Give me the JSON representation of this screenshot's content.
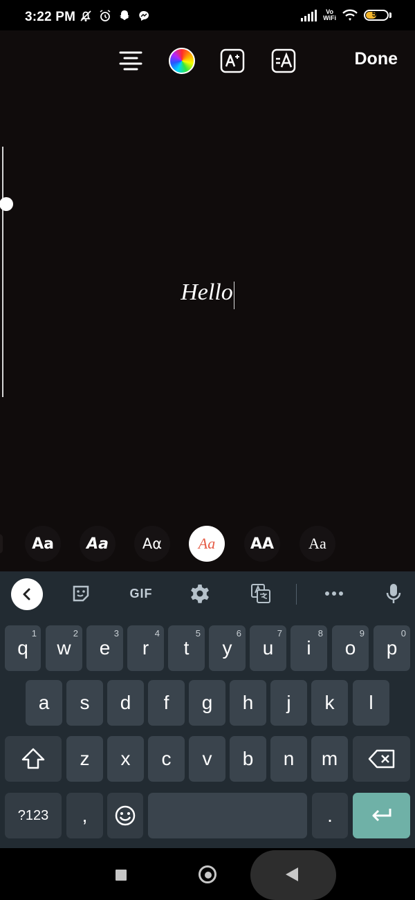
{
  "status_bar": {
    "time": "3:22 PM",
    "icons_left": [
      "muted-bell-icon",
      "alarm-icon",
      "snapchat-icon",
      "messenger-icon"
    ],
    "network_label_top": "Vo",
    "network_label_bottom": "WiFi",
    "battery_level": "55",
    "battery_fraction": 0.55
  },
  "toolbar": {
    "align_icon": "align-center-icon",
    "color_icon": "color-wheel-icon",
    "effects_icon": "text-effects-icon",
    "style_icon": "text-style-icon",
    "done_label": "Done"
  },
  "editor": {
    "text": "Hello",
    "size_slider_value": 0.77,
    "font_options": [
      {
        "label": "Aa",
        "style": "bold"
      },
      {
        "label": "Aa",
        "style": "bold-italic"
      },
      {
        "label": "Aα",
        "style": "rounded"
      },
      {
        "label": "Aa",
        "style": "serif-italic",
        "selected": true
      },
      {
        "label": "AA",
        "style": "caps"
      },
      {
        "label": "Aa",
        "style": "serif"
      }
    ],
    "selected_font_color": "#e55b45"
  },
  "keyboard": {
    "suggestions": {
      "back_icon": "chevron-left-icon",
      "sticker_icon": "sticker-icon",
      "gif_label": "GIF",
      "settings_icon": "gear-icon",
      "translate_icon": "translate-icon",
      "more_icon": "more-icon",
      "mic_icon": "mic-icon"
    },
    "row1": [
      {
        "key": "q",
        "num": "1"
      },
      {
        "key": "w",
        "num": "2"
      },
      {
        "key": "e",
        "num": "3"
      },
      {
        "key": "r",
        "num": "4"
      },
      {
        "key": "t",
        "num": "5"
      },
      {
        "key": "y",
        "num": "6"
      },
      {
        "key": "u",
        "num": "7"
      },
      {
        "key": "i",
        "num": "8"
      },
      {
        "key": "o",
        "num": "9"
      },
      {
        "key": "p",
        "num": "0"
      }
    ],
    "row2": [
      "a",
      "s",
      "d",
      "f",
      "g",
      "h",
      "j",
      "k",
      "l"
    ],
    "row3": [
      "z",
      "x",
      "c",
      "v",
      "b",
      "n",
      "m"
    ],
    "numbers_label": "?123",
    "comma_label": ",",
    "period_label": ".",
    "enter_color": "#6fb1a7"
  },
  "navigation": {
    "recents_icon": "square-icon",
    "home_icon": "circle-home-icon",
    "back_icon": "triangle-back-icon"
  }
}
